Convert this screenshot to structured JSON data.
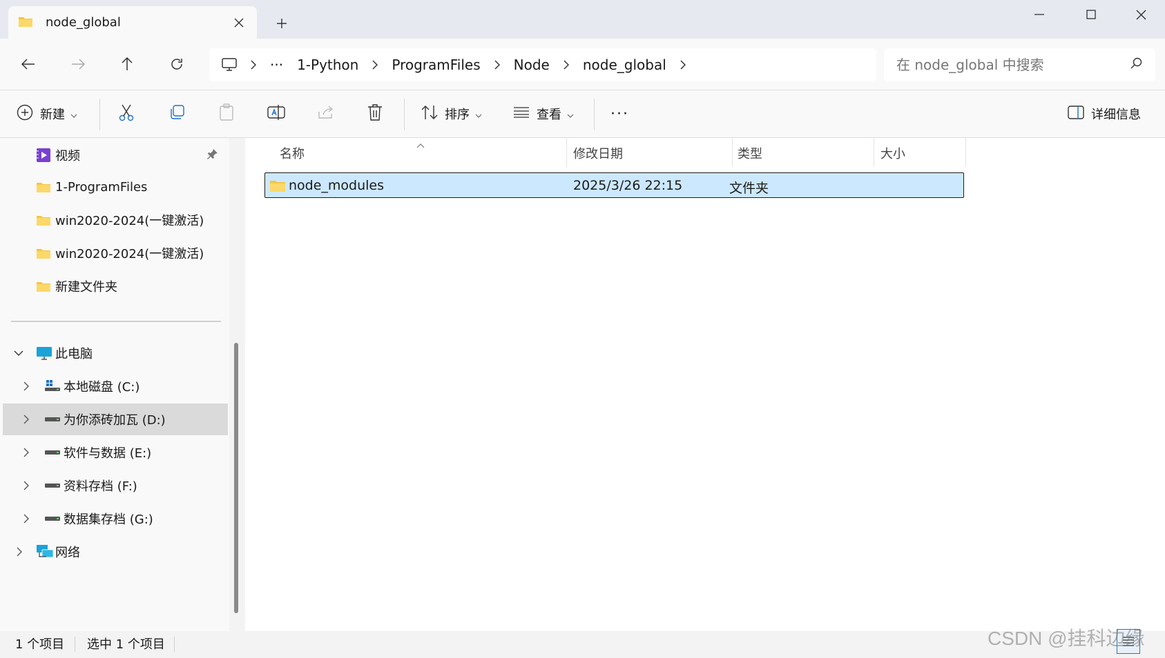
{
  "window": {
    "tab_title": "node_global",
    "new_tab_label": "+"
  },
  "address": {
    "ellipsis": "···",
    "crumbs": [
      "1-Python",
      "ProgramFiles",
      "Node",
      "node_global"
    ],
    "search_placeholder": "在 node_global 中搜索"
  },
  "commandbar": {
    "new_label": "新建",
    "sort_label": "排序",
    "view_label": "查看",
    "more_label": "···",
    "details_label": "详细信息"
  },
  "sidebar": {
    "quick_access": [
      {
        "label": "视频"
      },
      {
        "label": "1-ProgramFiles"
      },
      {
        "label": "win2020-2024(一键激活)"
      },
      {
        "label": "win2020-2024(一键激活)"
      },
      {
        "label": "新建文件夹"
      }
    ],
    "this_pc": "此电脑",
    "drives": [
      {
        "label": "本地磁盘 (C:)"
      },
      {
        "label": "为你添砖加瓦 (D:)"
      },
      {
        "label": "软件与数据 (E:)"
      },
      {
        "label": "资料存档 (F:)"
      },
      {
        "label": "数据集存档 (G:)"
      }
    ],
    "network": "网络"
  },
  "filelist": {
    "columns": {
      "name": "名称",
      "modified": "修改日期",
      "type": "类型",
      "size": "大小"
    },
    "rows": [
      {
        "name": "node_modules",
        "modified": "2025/3/26 22:15",
        "type": "文件夹",
        "size": ""
      }
    ]
  },
  "status": {
    "count": "1 个项目",
    "selected": "选中 1 个项目"
  },
  "watermark": "CSDN @挂科边缘",
  "colors": {
    "selection": "#cce8ff",
    "folder": "#f5c542",
    "accent": "#2a72c8"
  }
}
